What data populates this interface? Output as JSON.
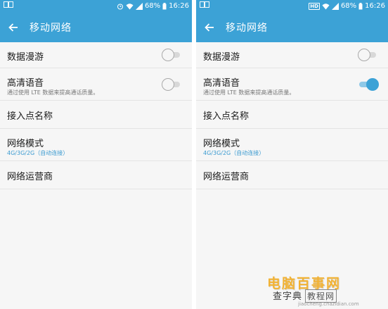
{
  "colors": {
    "accent": "#3ca2d6",
    "background": "#f6f6f6",
    "watermark": "#f2b233"
  },
  "screens": [
    {
      "statusbar": {
        "battery": "68%",
        "time": "16:26"
      },
      "appbar": {
        "back_icon": "arrow-left-icon",
        "title": "移动网络"
      },
      "settings": {
        "data_roaming": {
          "label": "数据漫游",
          "enabled": false
        },
        "hd_voice": {
          "label": "高清语音",
          "sub": "通过使用 LTE 数据来提高通话质量。",
          "enabled": false
        },
        "apn": {
          "label": "接入点名称"
        },
        "network_mode": {
          "label": "网络模式",
          "value": "4G/3G/2G（自动连接）"
        },
        "operators": {
          "label": "网络运营商"
        }
      }
    },
    {
      "statusbar": {
        "hd_badge": "HD",
        "battery": "68%",
        "time": "16:26"
      },
      "appbar": {
        "back_icon": "arrow-left-icon",
        "title": "移动网络"
      },
      "settings": {
        "data_roaming": {
          "label": "数据漫游",
          "enabled": false
        },
        "hd_voice": {
          "label": "高清语音",
          "sub": "通过使用 LTE 数据来提高通话质量。",
          "enabled": true
        },
        "apn": {
          "label": "接入点名称"
        },
        "network_mode": {
          "label": "网络模式",
          "value": "4G/3G/2G（自动连接）"
        },
        "operators": {
          "label": "网络运营商"
        }
      }
    }
  ],
  "watermark": {
    "main": "电脑百事网",
    "sub": "查字典",
    "box": "教程网",
    "url": "jiaocheng.chazidian.com"
  }
}
